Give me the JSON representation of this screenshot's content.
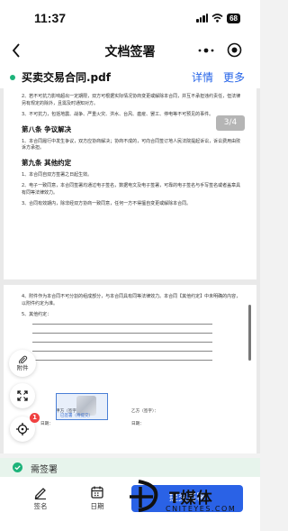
{
  "status_bar": {
    "time": "11:37",
    "battery": "68"
  },
  "nav": {
    "title": "文档签署"
  },
  "file": {
    "name": "买卖交易合同.pdf",
    "details_label": "详情",
    "more_label": "更多"
  },
  "page_indicator": "3/4",
  "doc": {
    "p2": "2、若不可抗力影响超出一定期限，双方可根据实际情况协商变更或解除本合同，并互不承担违约责任，但法律另有规定的除外，且需及时通知对方。",
    "p3": "3、不可抗力，包括地震、战争、严重火灾、洪水、台风、瘟疫、罢工、停电等不可预见的事件。",
    "s8_title": "第八条 争议解决",
    "s8_p1": "1、本合同履行中发生争议，双方应协商解决；协商不成的，可向合同签订地人民法院提起诉讼，诉讼费用由败诉方承担。",
    "s9_title": "第九条 其他约定",
    "s9_p1": "1、本合同自双方签署之日起生效。",
    "s9_p2": "2、电子一致同意，本合同签署均通过电子签名，数据电文及电子签署，可靠的电子签名与手写签名或者盖章具有同等法律效力。",
    "s9_p3": "3、合同有效期内，除非经双方协商一致同意，任何一方不得擅自变更或解除本合同。",
    "p4": "4、附件作为本合同不可分割的组成部分，与本合同具有同等法律效力。本合同【其他约定】中未明确的内容，以附件约定为准。",
    "p5": "5、其他约定：",
    "party_a": "甲方（签字）：",
    "party_b": "乙方（签字）：",
    "date_a": "日期：",
    "date_b": "日期：",
    "signed_text": "已签署（待提交）"
  },
  "floating": {
    "attach_label": "附件",
    "badge": "1"
  },
  "status_strip": {
    "text": "需签署"
  },
  "bottom_bar": {
    "sign_label": "签名",
    "date_label": "日期",
    "submit_label": "提交签署"
  },
  "watermark": {
    "brand": "T媒体",
    "site": "CNITEYES.COM"
  },
  "colors": {
    "accent": "#2a62e6",
    "green": "#1db37a",
    "badge_red": "#f04141"
  }
}
